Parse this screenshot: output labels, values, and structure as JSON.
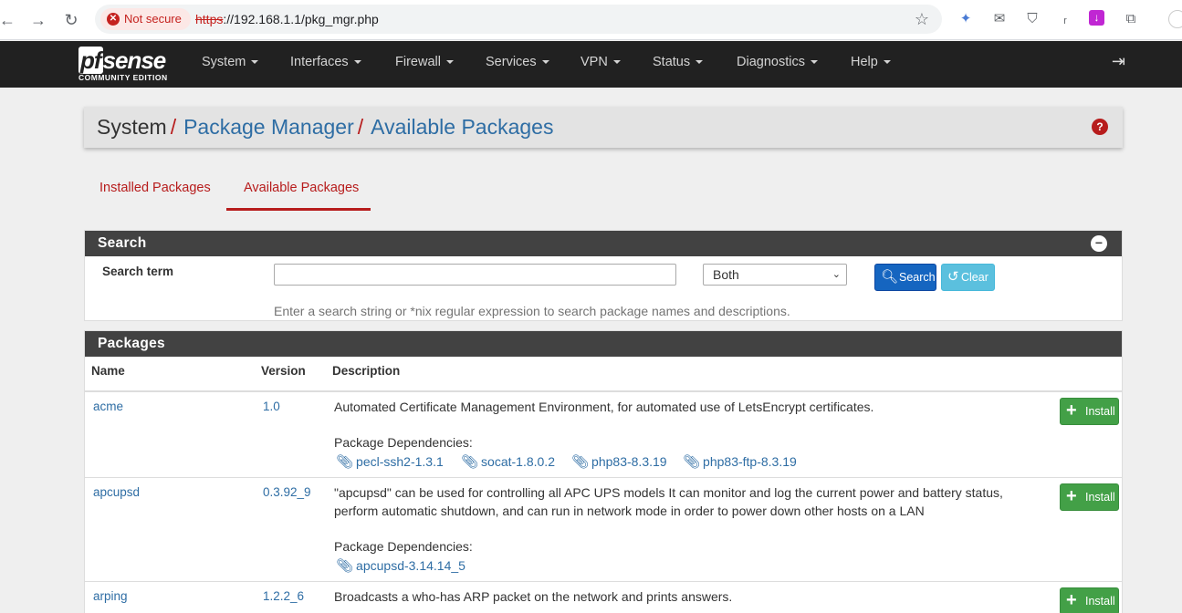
{
  "browser": {
    "security_label": "Not secure",
    "url_scheme": "https",
    "url_rest": "://192.168.1.1/pkg_mgr.php"
  },
  "nav": {
    "logo_text": "sense",
    "logo_prefix": "pf",
    "logo_sub": "COMMUNITY EDITION",
    "items": [
      "System",
      "Interfaces",
      "Firewall",
      "Services",
      "VPN",
      "Status",
      "Diagnostics",
      "Help"
    ]
  },
  "breadcrumb": {
    "root": "System",
    "level1": "Package Manager",
    "level2": "Available Packages",
    "separator": "/"
  },
  "tabs": {
    "installed": "Installed Packages",
    "available": "Available Packages"
  },
  "search_panel": {
    "title": "Search",
    "term_label": "Search term",
    "term_value": "",
    "scope_selected": "Both",
    "search_button": "Search",
    "clear_button": "Clear",
    "help_text": "Enter a search string or *nix regular expression to search package names and descriptions."
  },
  "packages_panel": {
    "title": "Packages",
    "columns": [
      "Name",
      "Version",
      "Description"
    ],
    "deps_label": "Package Dependencies:",
    "install_label": "Install",
    "rows": [
      {
        "name": "acme",
        "version": "1.0",
        "description": "Automated Certificate Management Environment, for automated use of LetsEncrypt certificates.",
        "dependencies": [
          "pecl-ssh2-1.3.1",
          "socat-1.8.0.2",
          "php83-8.3.19",
          "php83-ftp-8.3.19"
        ]
      },
      {
        "name": "apcupsd",
        "version": "0.3.92_9",
        "description": "\"apcupsd\" can be used for controlling all APC UPS models It can monitor and log the current power and battery status, perform automatic shutdown, and can run in network mode in order to power down other hosts on a LAN",
        "dependencies": [
          "apcupsd-3.14.14_5"
        ]
      },
      {
        "name": "arping",
        "version": "1.2.2_6",
        "description": "Broadcasts a who-has ARP packet on the network and prints answers.",
        "dependencies": []
      }
    ]
  }
}
